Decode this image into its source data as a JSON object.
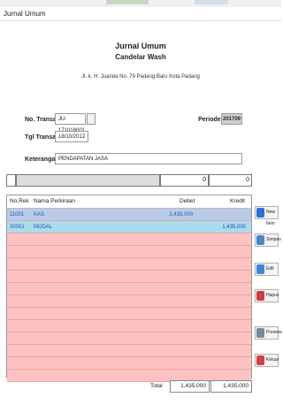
{
  "window": {
    "title": "Jurnal Umum"
  },
  "header": {
    "title": "Jurnal Umum",
    "company": "Candelar Wash",
    "address": "Jl. k. H. Juanda No. 79 Padang Baru Kota Padang"
  },
  "form": {
    "transaksi_label": "No. Transaksi :",
    "transaksi_value": "JU-171018001",
    "tgl_label": "Tgl Transaksi :",
    "tgl_value": "18/10/2017",
    "keterangan_label": "Keterangan :",
    "keterangan_value": "PENDAPATAN JASA",
    "periode_label": "Periode :",
    "periode_value": "201709"
  },
  "entry": {
    "debet": "0",
    "kredit": "0"
  },
  "table": {
    "headers": [
      "No.Rek",
      "Nama Perkiraan",
      "Debet",
      "Kredit"
    ],
    "rows": [
      {
        "norek": "11001",
        "nama": "KAS",
        "debet": "1,435,000",
        "kredit": ""
      },
      {
        "norek": "30001",
        "nama": "MODAL",
        "debet": "",
        "kredit": "1,435,000"
      }
    ],
    "empty_rows": 12,
    "colors": {
      "row1": "#b9cbe7",
      "row2": "#a8ddee",
      "empty": "#ffc2c2"
    }
  },
  "footer": {
    "total_label": "Total",
    "total_debet": "1,435,000",
    "total_kredit": "1,435,000"
  },
  "actions": [
    {
      "label": "New Item",
      "icon": "new-item-icon",
      "color": "#2f6fd8"
    },
    {
      "label": "Simpan",
      "icon": "save-icon",
      "color": "#4a86d6"
    },
    {
      "label": "Edit",
      "icon": "edit-icon",
      "color": "#3f86d8"
    },
    {
      "label": "Hapus",
      "icon": "delete-icon",
      "color": "#d33c3c"
    },
    {
      "label": "Preview",
      "icon": "preview-icon",
      "color": "#7a8a9a"
    },
    {
      "label": "Keluar",
      "icon": "exit-icon",
      "color": "#d94040"
    }
  ]
}
